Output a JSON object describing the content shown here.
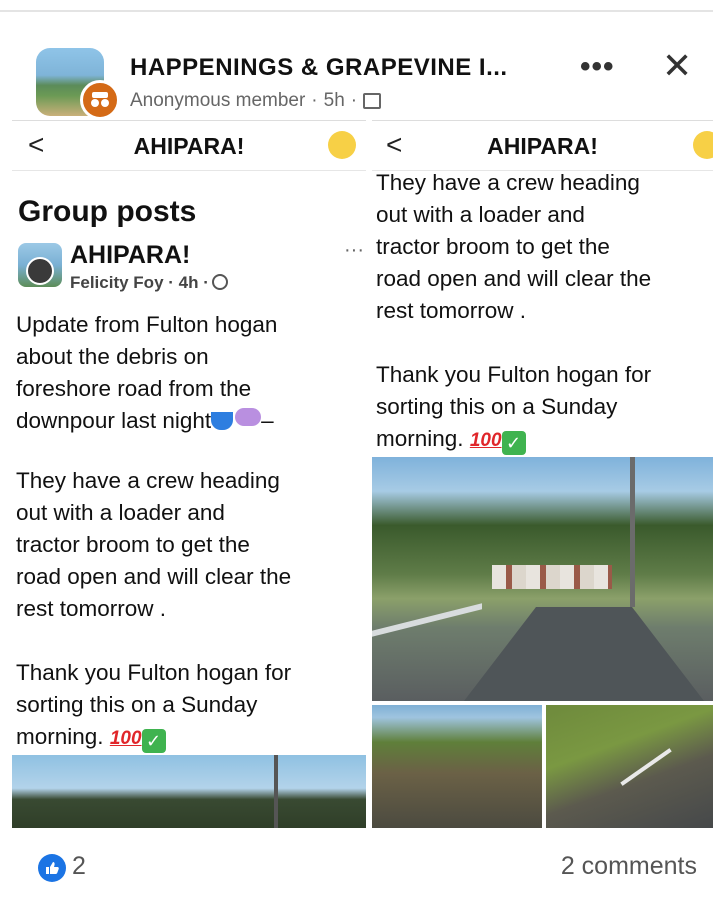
{
  "header": {
    "group_name": "HAPPENINGS & GRAPEVINE I...",
    "author": "Anonymous member",
    "time": "5h",
    "more_label": "•••",
    "close_label": "✕"
  },
  "left_panel": {
    "nav_back": "<",
    "nav_title": "AHIPARA!",
    "section_heading": "Group posts",
    "post": {
      "group": "AHIPARA!",
      "author_time": "Felicity Foy · 4h ·",
      "paragraph1": "Update from Fulton hogan\nabout the debris on\nforeshore road from the\ndownpour last night",
      "paragraph2": "They have a crew heading\nout with a loader and\ntractor broom to get the\nroad open and will clear  the\nrest tomorrow .",
      "paragraph3": "Thank you Fulton hogan for\nsorting this on a Sunday\nmorning."
    }
  },
  "right_panel": {
    "nav_back": "<",
    "nav_title": "AHIPARA!",
    "paragraph2": "They have a crew heading\nout with a loader and\ntractor broom to get the\nroad open and will clear  the\nrest tomorrow .",
    "paragraph3": "Thank you Fulton hogan for\nsorting this on a Sunday\nmorning."
  },
  "footer": {
    "like_count": "2",
    "comment_count": "2 comments"
  },
  "emoji": {
    "hundred": "100",
    "check": "✓"
  },
  "colors": {
    "like_blue": "#1b74e4",
    "anon_badge": "#d46a16"
  },
  "icons": [
    "anonymous-icon",
    "globe-icon",
    "more-icon",
    "close-icon",
    "back-icon",
    "smile-emoji-icon",
    "like-icon"
  ]
}
